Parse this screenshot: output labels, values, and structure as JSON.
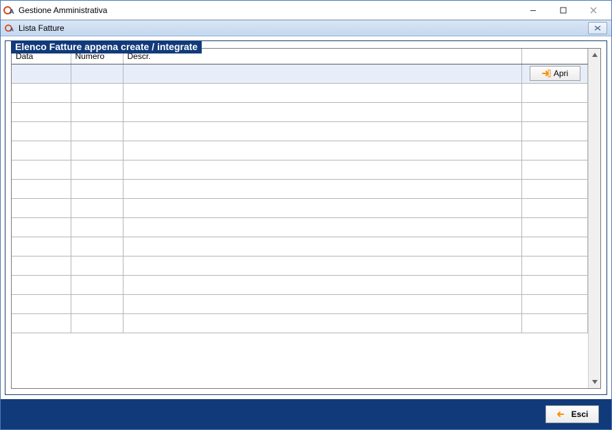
{
  "window": {
    "title": "Gestione Amministrativa"
  },
  "child_window": {
    "title": "Lista Fatture"
  },
  "group": {
    "legend": "Elenco Fatture appena create / integrate"
  },
  "grid": {
    "columns": {
      "data": "Data",
      "numero": "Numero",
      "descr": "Descr."
    },
    "apri_label": "Apri",
    "rows": [
      {
        "data": "",
        "numero": "",
        "descr": "",
        "selected": true,
        "show_apri": true
      },
      {
        "data": "",
        "numero": "",
        "descr": "",
        "selected": false,
        "show_apri": false
      },
      {
        "data": "",
        "numero": "",
        "descr": "",
        "selected": false,
        "show_apri": false
      },
      {
        "data": "",
        "numero": "",
        "descr": "",
        "selected": false,
        "show_apri": false
      },
      {
        "data": "",
        "numero": "",
        "descr": "",
        "selected": false,
        "show_apri": false
      },
      {
        "data": "",
        "numero": "",
        "descr": "",
        "selected": false,
        "show_apri": false
      },
      {
        "data": "",
        "numero": "",
        "descr": "",
        "selected": false,
        "show_apri": false
      },
      {
        "data": "",
        "numero": "",
        "descr": "",
        "selected": false,
        "show_apri": false
      },
      {
        "data": "",
        "numero": "",
        "descr": "",
        "selected": false,
        "show_apri": false
      },
      {
        "data": "",
        "numero": "",
        "descr": "",
        "selected": false,
        "show_apri": false
      },
      {
        "data": "",
        "numero": "",
        "descr": "",
        "selected": false,
        "show_apri": false
      },
      {
        "data": "",
        "numero": "",
        "descr": "",
        "selected": false,
        "show_apri": false
      },
      {
        "data": "",
        "numero": "",
        "descr": "",
        "selected": false,
        "show_apri": false
      },
      {
        "data": "",
        "numero": "",
        "descr": "",
        "selected": false,
        "show_apri": false
      }
    ]
  },
  "footer": {
    "esci_label": "Esci"
  },
  "colors": {
    "accent_dark_blue": "#113a7a",
    "accent_orange": "#ff8c00"
  }
}
